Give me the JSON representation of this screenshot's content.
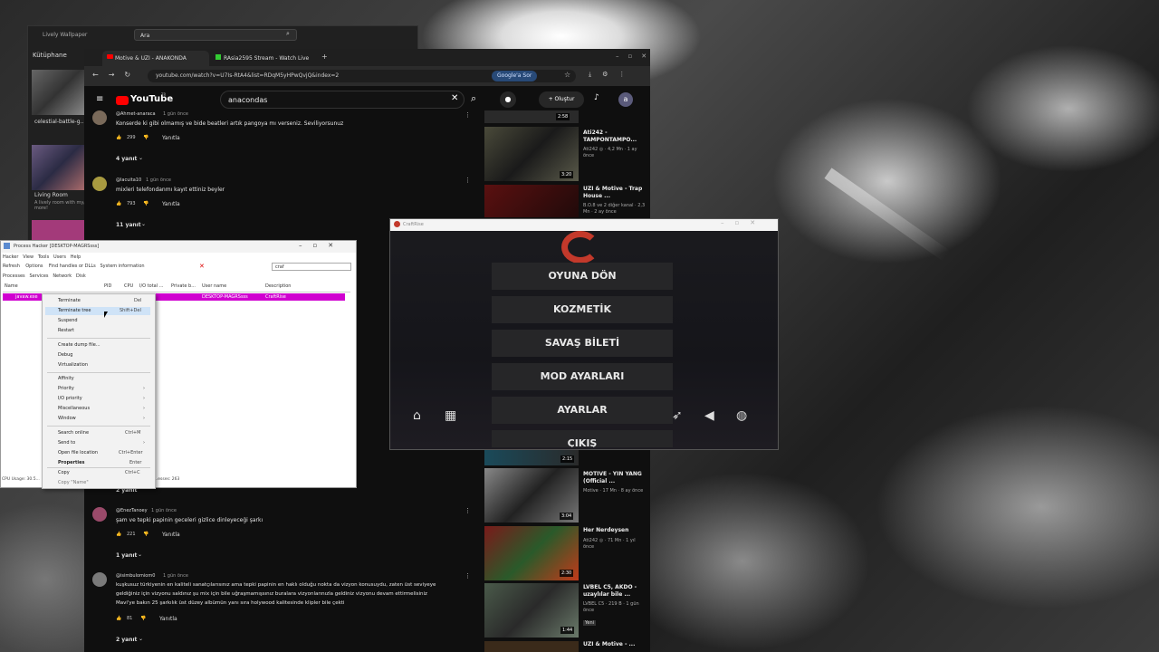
{
  "lively": {
    "title": "Lively Wallpaper",
    "search_placeholder": "Ara",
    "library_label": "Kütüphane",
    "items": [
      {
        "title": "celestial-battle-g...",
        "sub": ""
      },
      {
        "title": "Living Room",
        "sub": "A lively room with my/ more!"
      }
    ]
  },
  "chrome": {
    "tabs": [
      {
        "label": "Motive & UZI - ANAKONDA"
      },
      {
        "label": "RAsia2595 Stream - Watch Live"
      }
    ],
    "url": "youtube.com/watch?v=U7Is-RtA4&list=RDqM5yHPwQvjQ&index=2",
    "google_btn": "Google'a Sor"
  },
  "youtube": {
    "logo": "YouTube",
    "logo_sup": "TR",
    "search_value": "anacondas",
    "create_label": "+ Oluştur",
    "avatar_letter": "a",
    "comments": [
      {
        "user": "@Ahmet-anaraca",
        "time": "1 gün önce",
        "text": "Konserde ki gibi olmamış ve bide beatleri artık pangoya mı verseniz. Seviliyorsunuz",
        "likes": "299",
        "reply": "Yanıtla",
        "replies": "4 yanıt"
      },
      {
        "user": "@lacuita10",
        "time": "1 gün önce",
        "text": "mixleri telefondanmı kayıt ettiniz beyler",
        "likes": "793",
        "reply": "Yanıtla",
        "replies": "11 yanıt"
      },
      {
        "user": "@EnezTanoey",
        "time": "1 gün önce",
        "text": "şam ve tepki papinin geceleri gizlice dinleyeceği şarkı",
        "likes": "221",
        "reply": "Yanıtla",
        "replies": "1 yanıt"
      },
      {
        "user": "@isimbulomiom0",
        "time": "1 gün önce",
        "text1": "kuşkusuz türkiyenin en kaliteli sanatçılarısınız ama tepki papinin en haklı olduğu nokta da vizyon konusuydu, zaten üst seviyeye",
        "text2": "geldiğiniz için vizyonu saldınız şu mix için bile uğraşmamışsınız buralara vizyonlarınızla geldiniz vizyonu devam ettirmelisiniz",
        "text3": "Mavi'ye bakın 25 şarkılık üst düzey albümün yanı sıra holywood kalitesinde klipler bile çekti",
        "likes": "81",
        "reply": "Yanıtla",
        "replies": "2 yanıt"
      }
    ],
    "hidden_replies": "2 yanıt",
    "videos": [
      {
        "title": "",
        "meta": "",
        "dur": "2:58"
      },
      {
        "title": "Ati242 - TAMPONTAMPO...",
        "meta": "Ati242 ◎ · 4,2 Mn · 1 ay önce",
        "dur": "3:20"
      },
      {
        "title": "UZI & Motive - Trap House ...",
        "meta": "B.O.8 ve 2 diğer kanal · 2,3 Mn · 2 ay önce",
        "dur": ""
      },
      {
        "title": "",
        "meta": "",
        "dur": "2:15"
      },
      {
        "title": "MOTIVE - YIN YANG (Official ...",
        "meta": "Motive · 17 Mn · 8 ay önce",
        "dur": "3:04"
      },
      {
        "title": "Her Nerdeysen",
        "meta": "Ati242 ◎ · 71 Mn · 1 yıl önce",
        "dur": "2:30"
      },
      {
        "title": "LVBEL C5, AKDO - uzaylılar bile ...",
        "meta": "LVBEL C5 · 219 B · 1 gün önce",
        "badge": "Yeni",
        "dur": "1:44"
      },
      {
        "title": "UZI & Motive - ...",
        "meta": "",
        "dur": ""
      }
    ]
  },
  "process_hacker": {
    "title": "Process Hacker [DESKTOP-MAGRSsss]",
    "menu": [
      "Hacker",
      "View",
      "Tools",
      "Users",
      "Help"
    ],
    "toolbar": [
      "Refresh",
      "Options",
      "Find handles or DLLs",
      "System information"
    ],
    "filter": "craf",
    "tabs": [
      "Processes",
      "Services",
      "Network",
      "Disk"
    ],
    "columns": [
      "Name",
      "PID",
      "CPU",
      "I/O total ...",
      "Private b...",
      "User name",
      "Description"
    ],
    "selected_row": {
      "name": "javaw.exe",
      "user": "DESKTOP-MAGRSsss",
      "desc": "CraftRise"
    },
    "status": "CPU Usage: 30.5...",
    "status2": "...esses: 263"
  },
  "context_menu": {
    "items": [
      {
        "label": "Terminate",
        "key": "Del"
      },
      {
        "label": "Terminate tree",
        "key": "Shift+Del"
      },
      {
        "label": "Suspend",
        "key": ""
      },
      {
        "label": "Restart",
        "key": ""
      },
      {
        "label": "Create dump file...",
        "key": ""
      },
      {
        "label": "Debug",
        "key": ""
      },
      {
        "label": "Virtualization",
        "key": ""
      },
      {
        "label": "Affinity",
        "key": ""
      },
      {
        "label": "Priority",
        "key": "",
        "sub": true
      },
      {
        "label": "I/O priority",
        "key": "",
        "sub": true
      },
      {
        "label": "Miscellaneous",
        "key": "",
        "sub": true
      },
      {
        "label": "Window",
        "key": "",
        "sub": true
      },
      {
        "label": "Search online",
        "key": "Ctrl+M"
      },
      {
        "label": "Send to",
        "key": "",
        "sub": true
      },
      {
        "label": "Open file location",
        "key": "Ctrl+Enter"
      },
      {
        "label": "Properties",
        "key": "Enter"
      },
      {
        "label": "Copy",
        "key": "Ctrl+C"
      },
      {
        "label": "Copy \"Name\"",
        "key": ""
      }
    ]
  },
  "craftrise": {
    "title": "CraftRise",
    "buttons": [
      "OYUNA DÖN",
      "KOZMETİK",
      "SAVAŞ BİLETİ",
      "MOD AYARLARI",
      "AYARLAR",
      "ÇIKIŞ"
    ],
    "colors": {
      "accent": "#c3392b",
      "button_bg": "#262628"
    }
  }
}
